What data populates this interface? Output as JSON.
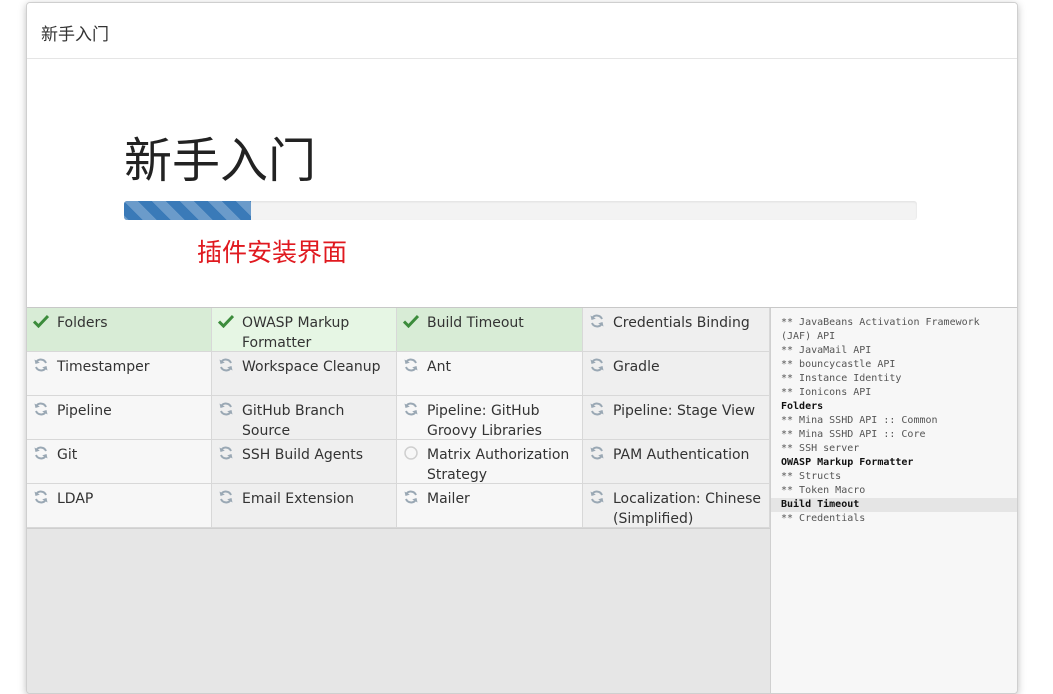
{
  "dialog": {
    "title": "新手入门"
  },
  "jumbotron": {
    "heading": "新手入门",
    "progress_percent": 16,
    "annotation": "插件安装界面",
    "annotation_color": "#e0191f"
  },
  "plugins": [
    {
      "name": "Folders",
      "status": "success"
    },
    {
      "name": "OWASP Markup Formatter",
      "status": "success"
    },
    {
      "name": "Build Timeout",
      "status": "success"
    },
    {
      "name": "Credentials Binding",
      "status": "installing"
    },
    {
      "name": "Timestamper",
      "status": "installing"
    },
    {
      "name": "Workspace Cleanup",
      "status": "installing"
    },
    {
      "name": "Ant",
      "status": "installing"
    },
    {
      "name": "Gradle",
      "status": "installing"
    },
    {
      "name": "Pipeline",
      "status": "installing"
    },
    {
      "name": "GitHub Branch Source",
      "status": "installing"
    },
    {
      "name": "Pipeline: GitHub Groovy Libraries",
      "status": "installing"
    },
    {
      "name": "Pipeline: Stage View",
      "status": "installing"
    },
    {
      "name": "Git",
      "status": "installing"
    },
    {
      "name": "SSH Build Agents",
      "status": "installing"
    },
    {
      "name": "Matrix Authorization Strategy",
      "status": "pending"
    },
    {
      "name": "PAM Authentication",
      "status": "installing"
    },
    {
      "name": "LDAP",
      "status": "installing"
    },
    {
      "name": "Email Extension",
      "status": "installing"
    },
    {
      "name": "Mailer",
      "status": "installing"
    },
    {
      "name": "Localization: Chinese (Simplified)",
      "status": "installing"
    }
  ],
  "log": [
    {
      "text": "** JavaBeans Activation Framework (JAF) API",
      "kind": "dep"
    },
    {
      "text": "** JavaMail API",
      "kind": "dep"
    },
    {
      "text": "** bouncycastle API",
      "kind": "dep"
    },
    {
      "text": "** Instance Identity",
      "kind": "dep"
    },
    {
      "text": "** Ionicons API",
      "kind": "dep"
    },
    {
      "text": "Folders",
      "kind": "plugin"
    },
    {
      "text": "** Mina SSHD API :: Common",
      "kind": "dep"
    },
    {
      "text": "** Mina SSHD API :: Core",
      "kind": "dep"
    },
    {
      "text": "** SSH server",
      "kind": "dep"
    },
    {
      "text": "OWASP Markup Formatter",
      "kind": "plugin"
    },
    {
      "text": "** Structs",
      "kind": "dep"
    },
    {
      "text": "** Token Macro",
      "kind": "dep"
    },
    {
      "text": "Build Timeout",
      "kind": "current"
    },
    {
      "text": "** Credentials",
      "kind": "dep"
    }
  ],
  "colors": {
    "success": "#3c8c3c",
    "installing": "#9aa8b4",
    "pending": "#cfcfcf",
    "progress": "#3a7ab8"
  },
  "icons": {
    "success": "check-icon",
    "installing": "refresh-icon",
    "pending": "circle-icon"
  }
}
